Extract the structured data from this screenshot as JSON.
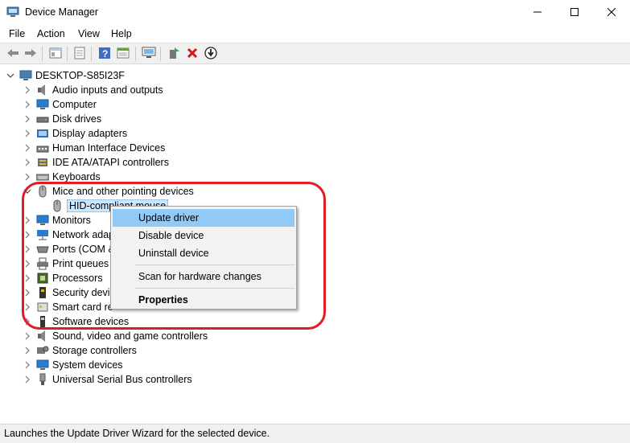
{
  "window": {
    "title": "Device Manager",
    "app_icon": "device-manager-icon",
    "controls": [
      "minimize-icon",
      "maximize-icon",
      "close-icon"
    ]
  },
  "menu": [
    "File",
    "Action",
    "View",
    "Help"
  ],
  "toolbar": {
    "buttons": [
      "back-icon",
      "forward-icon",
      "show-hide-icon",
      "properties-icon",
      "help-icon",
      "view-icon",
      "scan-hardware-icon",
      "update-driver-icon",
      "uninstall-icon",
      "download-icon"
    ]
  },
  "tree": {
    "root": "DESKTOP-S85I23F",
    "categories": [
      {
        "label": "Audio inputs and outputs",
        "icon": "speaker-icon"
      },
      {
        "label": "Computer",
        "icon": "monitor-icon"
      },
      {
        "label": "Disk drives",
        "icon": "disk-icon"
      },
      {
        "label": "Display adapters",
        "icon": "display-adapter-icon"
      },
      {
        "label": "Human Interface Devices",
        "icon": "hid-icon"
      },
      {
        "label": "IDE ATA/ATAPI controllers",
        "icon": "ide-icon"
      },
      {
        "label": "Keyboards",
        "icon": "keyboard-icon"
      },
      {
        "label": "Mice and other pointing devices",
        "icon": "mouse-icon",
        "expanded": true,
        "children": [
          {
            "label": "HID-compliant mouse",
            "icon": "mouse-icon",
            "selected": true
          }
        ]
      },
      {
        "label": "Monitors",
        "icon": "monitor-icon"
      },
      {
        "label": "Network adap",
        "icon": "network-icon"
      },
      {
        "label": "Ports (COM &",
        "icon": "port-icon"
      },
      {
        "label": "Print queues",
        "icon": "printer-icon"
      },
      {
        "label": "Processors",
        "icon": "processor-icon"
      },
      {
        "label": "Security devic",
        "icon": "security-icon"
      },
      {
        "label": "Smart card re",
        "icon": "smart-card-icon"
      },
      {
        "label": "Software devices",
        "icon": "software-device-icon"
      },
      {
        "label": "Sound, video and game controllers",
        "icon": "speaker-icon"
      },
      {
        "label": "Storage controllers",
        "icon": "storage-icon"
      },
      {
        "label": "System devices",
        "icon": "system-icon"
      },
      {
        "label": "Universal Serial Bus controllers",
        "icon": "usb-icon"
      }
    ]
  },
  "context_menu": {
    "items": [
      {
        "label": "Update driver",
        "highlighted": true
      },
      {
        "label": "Disable device"
      },
      {
        "label": "Uninstall device"
      },
      {
        "label": "Scan for hardware changes"
      },
      {
        "label": "Properties",
        "bold": true
      }
    ]
  },
  "status_bar": {
    "text": "Launches the Update Driver Wizard for the selected device."
  },
  "colors": {
    "annotation": "#e01c24",
    "selection": "#cce8ff",
    "menu_highlight": "#91c9f7"
  }
}
